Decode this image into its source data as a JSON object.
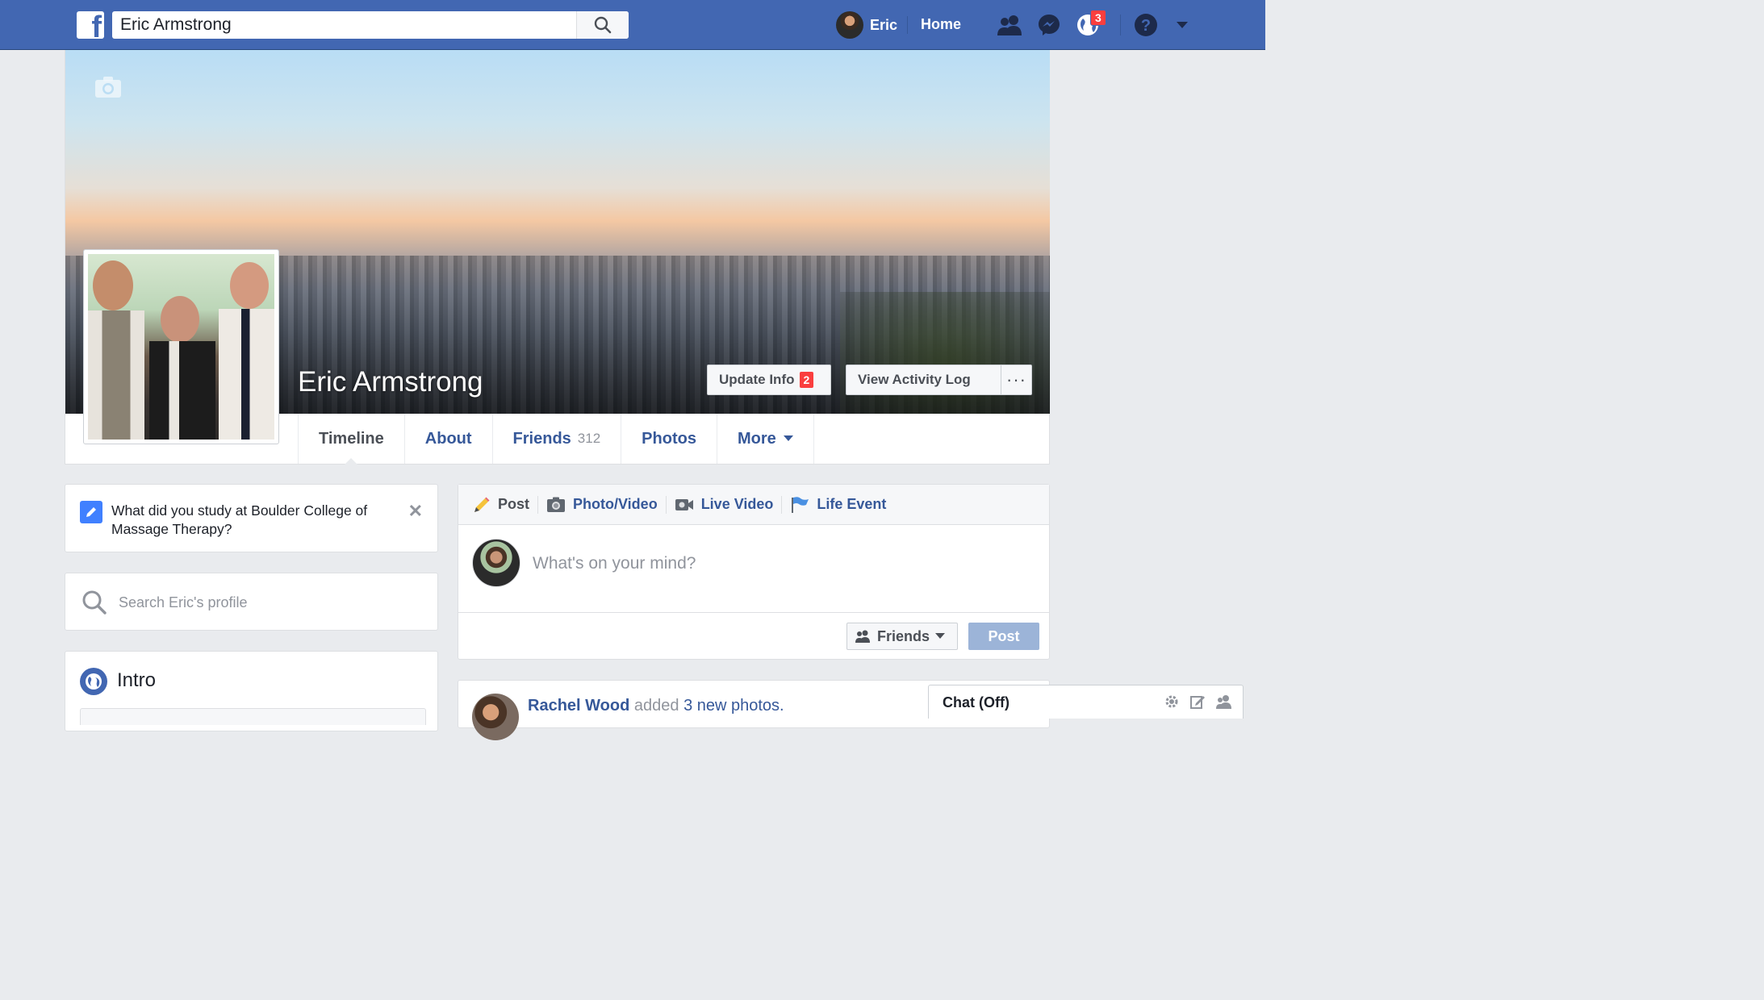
{
  "topbar": {
    "logo": "f",
    "search_value": "Eric Armstrong",
    "user_name": "Eric",
    "home_label": "Home",
    "notifications_count": "3",
    "colors": {
      "bar": "#4267b2",
      "badge": "#fa3e3e"
    }
  },
  "profile": {
    "name": "Eric Armstrong",
    "update_info_label": "Update Info",
    "update_info_badge": "2",
    "activity_log_label": "View Activity Log",
    "more_dots": "···"
  },
  "tabs": [
    {
      "label": "Timeline"
    },
    {
      "label": "About"
    },
    {
      "label": "Friends",
      "count": "312"
    },
    {
      "label": "Photos"
    },
    {
      "label": "More"
    }
  ],
  "question": {
    "text": "What did you study at Boulder College of Massage Therapy?",
    "close": "✕"
  },
  "profile_search": {
    "placeholder": "Search Eric's profile"
  },
  "intro": {
    "title": "Intro"
  },
  "composer": {
    "tabs": [
      {
        "label": "Post",
        "icon": "pencil-icon"
      },
      {
        "label": "Photo/Video",
        "icon": "camera-icon"
      },
      {
        "label": "Live Video",
        "icon": "video-camera-icon"
      },
      {
        "label": "Life Event",
        "icon": "flag-icon"
      }
    ],
    "placeholder": "What's on your mind?",
    "audience_label": "Friends",
    "post_label": "Post"
  },
  "feed": {
    "author": "Rachel Wood",
    "action": "added",
    "object": "3 new photos."
  },
  "chat": {
    "label": "Chat (Off)"
  }
}
